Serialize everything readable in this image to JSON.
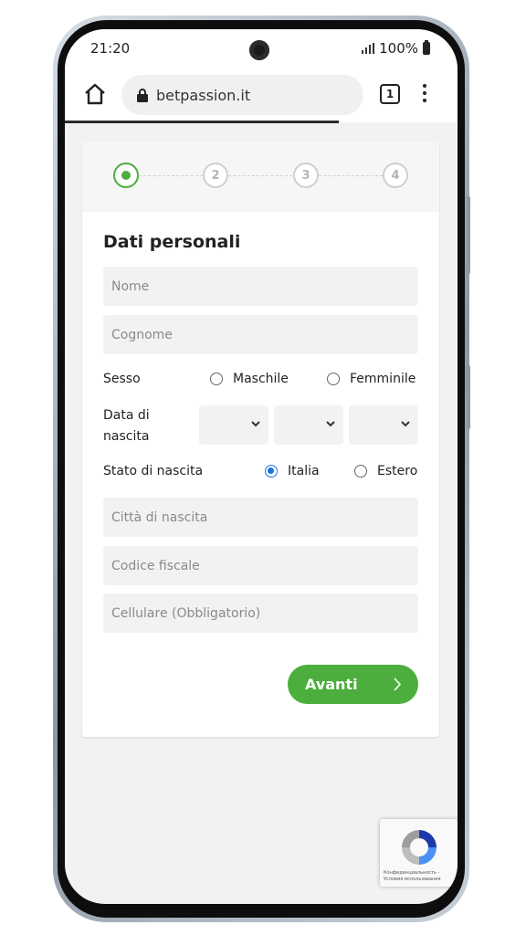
{
  "status_bar": {
    "time": "21:20",
    "battery": "100%"
  },
  "browser": {
    "url": "betpassion.it",
    "tab_count": "1"
  },
  "stepper": {
    "steps": [
      "",
      "2",
      "3",
      "4"
    ],
    "active_step": 1
  },
  "form": {
    "title": "Dati personali",
    "nome_placeholder": "Nome",
    "cognome_placeholder": "Cognome",
    "sesso_label": "Sesso",
    "sesso_options": [
      "Maschile",
      "Femminile"
    ],
    "data_label_line1": "Data di",
    "data_label_line2": "nascita",
    "stato_label": "Stato di nascita",
    "stato_options": [
      "Italia",
      "Estero"
    ],
    "stato_selected": "Italia",
    "citta_placeholder": "Città di nascita",
    "codice_placeholder": "Codice fiscale",
    "cellulare_placeholder": "Cellulare (Obbligatorio)",
    "submit_label": "Avanti"
  },
  "recaptcha": {
    "line1": "Конфиденциальность -",
    "line2": "Условия использования"
  },
  "colors": {
    "accent": "#4cae3c",
    "radio_checked": "#1a73e8"
  }
}
